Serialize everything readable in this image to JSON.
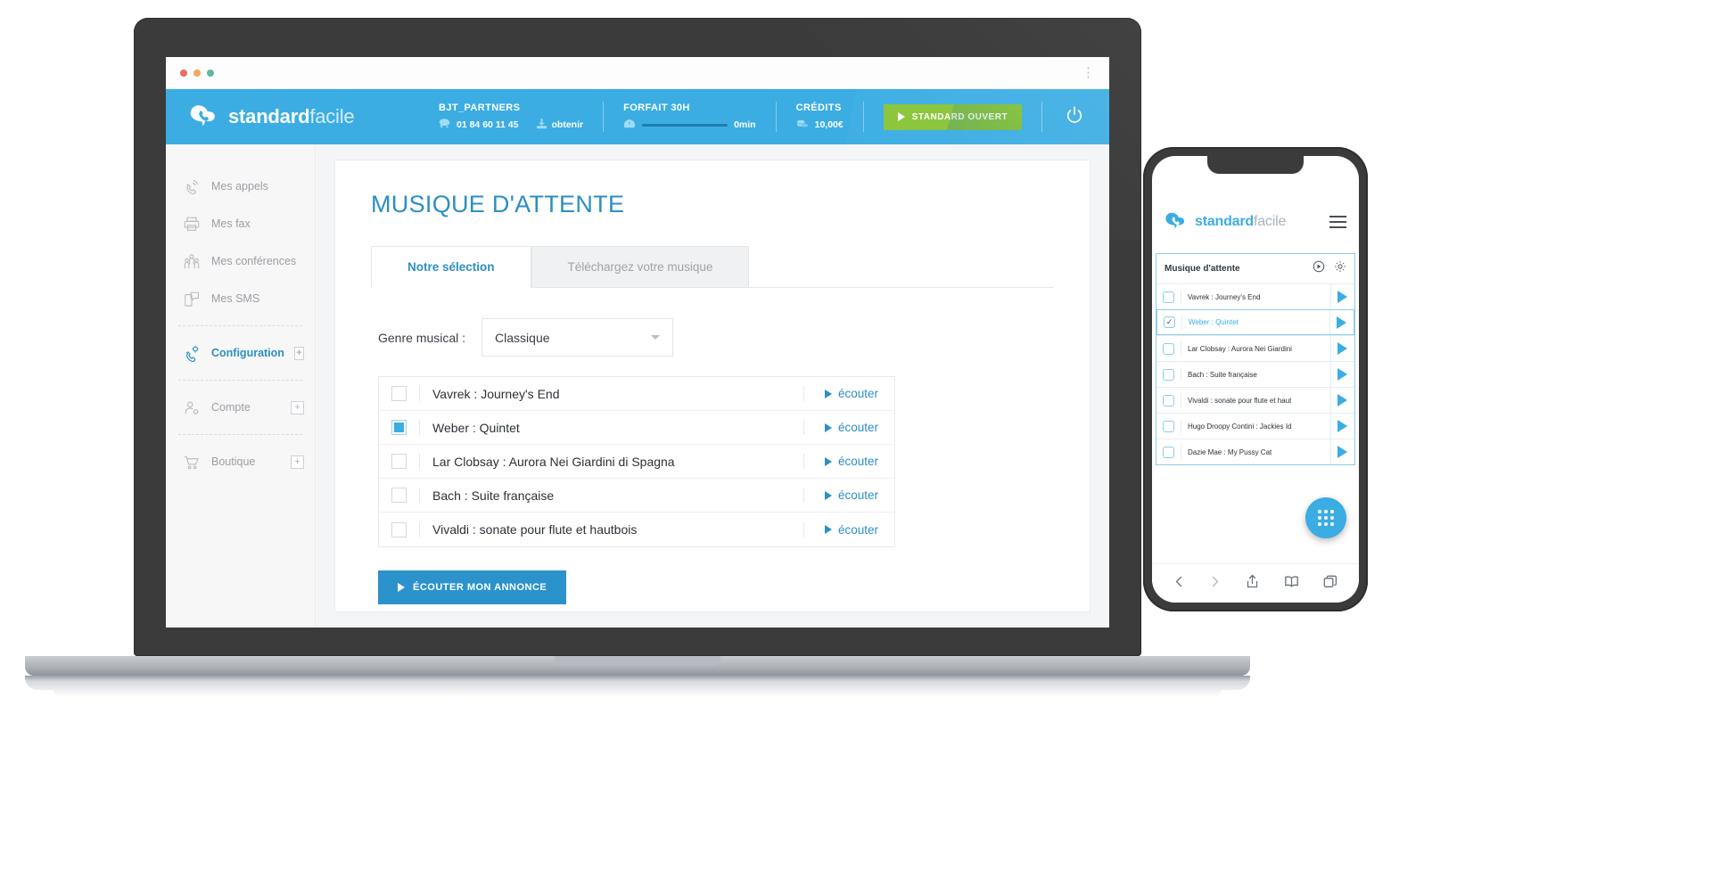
{
  "browser": {
    "traffic_lights": [
      "close",
      "minimize",
      "maximize"
    ],
    "menu_icon": "kebab-menu-icon"
  },
  "header": {
    "brand_bold": "standard",
    "brand_light": "facile",
    "account": {
      "name": "BJT_PARTNERS",
      "phone": "01 84 60 11 45",
      "obtain_label": "obtenir"
    },
    "plan": {
      "title": "FORFAIT 30H",
      "value": "0min"
    },
    "credits": {
      "title": "CRÉDITS",
      "value": "10,00€"
    },
    "status_button": "STANDARD OUVERT",
    "power_icon": "power-icon"
  },
  "sidebar": {
    "items": [
      {
        "label": "Mes appels",
        "icon": "phone-call-icon",
        "active": false,
        "plus": false
      },
      {
        "label": "Mes fax",
        "icon": "printer-icon",
        "active": false,
        "plus": false
      },
      {
        "label": "Mes conférences",
        "icon": "users-icon",
        "active": false,
        "plus": false
      },
      {
        "label": "Mes SMS",
        "icon": "sms-icon",
        "active": false,
        "plus": false
      },
      {
        "label": "Configuration",
        "icon": "phone-gear-icon",
        "active": true,
        "plus": true
      },
      {
        "label": "Compte",
        "icon": "user-gear-icon",
        "active": false,
        "plus": true
      },
      {
        "label": "Boutique",
        "icon": "cart-icon",
        "active": false,
        "plus": true
      }
    ],
    "plus_label": "+"
  },
  "main": {
    "page_title": "MUSIQUE D'ATTENTE",
    "tabs": [
      {
        "label": "Notre sélection",
        "active": true
      },
      {
        "label": "Téléchargez votre musique",
        "active": false
      }
    ],
    "genre": {
      "label": "Genre musical :",
      "selected": "Classique",
      "options": [
        "Classique"
      ]
    },
    "listen_label": "écouter",
    "tracks": [
      {
        "name": "Vavrek : Journey's End",
        "checked": false
      },
      {
        "name": "Weber : Quintet",
        "checked": true
      },
      {
        "name": "Lar Clobsay : Aurora Nei Giardini di Spagna",
        "checked": false
      },
      {
        "name": "Bach : Suite française",
        "checked": false
      },
      {
        "name": "Vivaldi : sonate pour flute et hautbois",
        "checked": false
      }
    ],
    "cta_label": "ÉCOUTER MON ANNONCE"
  },
  "phone": {
    "brand_bold": "standard",
    "brand_light": "facile",
    "menu_icon": "hamburger-icon",
    "panel_title": "Musique d'attente",
    "panel_icons": [
      "play-circle-icon",
      "gear-icon"
    ],
    "tracks": [
      {
        "name": "Vavrek : Journey's End",
        "checked": false
      },
      {
        "name": "Weber : Quintet",
        "checked": true
      },
      {
        "name": "Lar Clobsay : Aurora Nei Giardini",
        "checked": false
      },
      {
        "name": "Bach : Suite française",
        "checked": false
      },
      {
        "name": "Vivaldi : sonate pour flute et haut",
        "checked": false
      },
      {
        "name": "Hugo Droopy Contini : Jackies Id",
        "checked": false
      },
      {
        "name": "Dazie Mae : My Pussy Cat",
        "checked": false
      }
    ],
    "check_glyph": "✓",
    "fab_icon": "dialpad-icon",
    "bottom_bar": [
      "back-icon",
      "forward-icon",
      "share-icon",
      "bookmarks-icon",
      "tabs-icon"
    ]
  },
  "colors": {
    "brand_blue": "#3bade3",
    "accent_blue": "#2b8fc4",
    "green": "#8cc63e",
    "cta_blue": "#2b92cc"
  }
}
